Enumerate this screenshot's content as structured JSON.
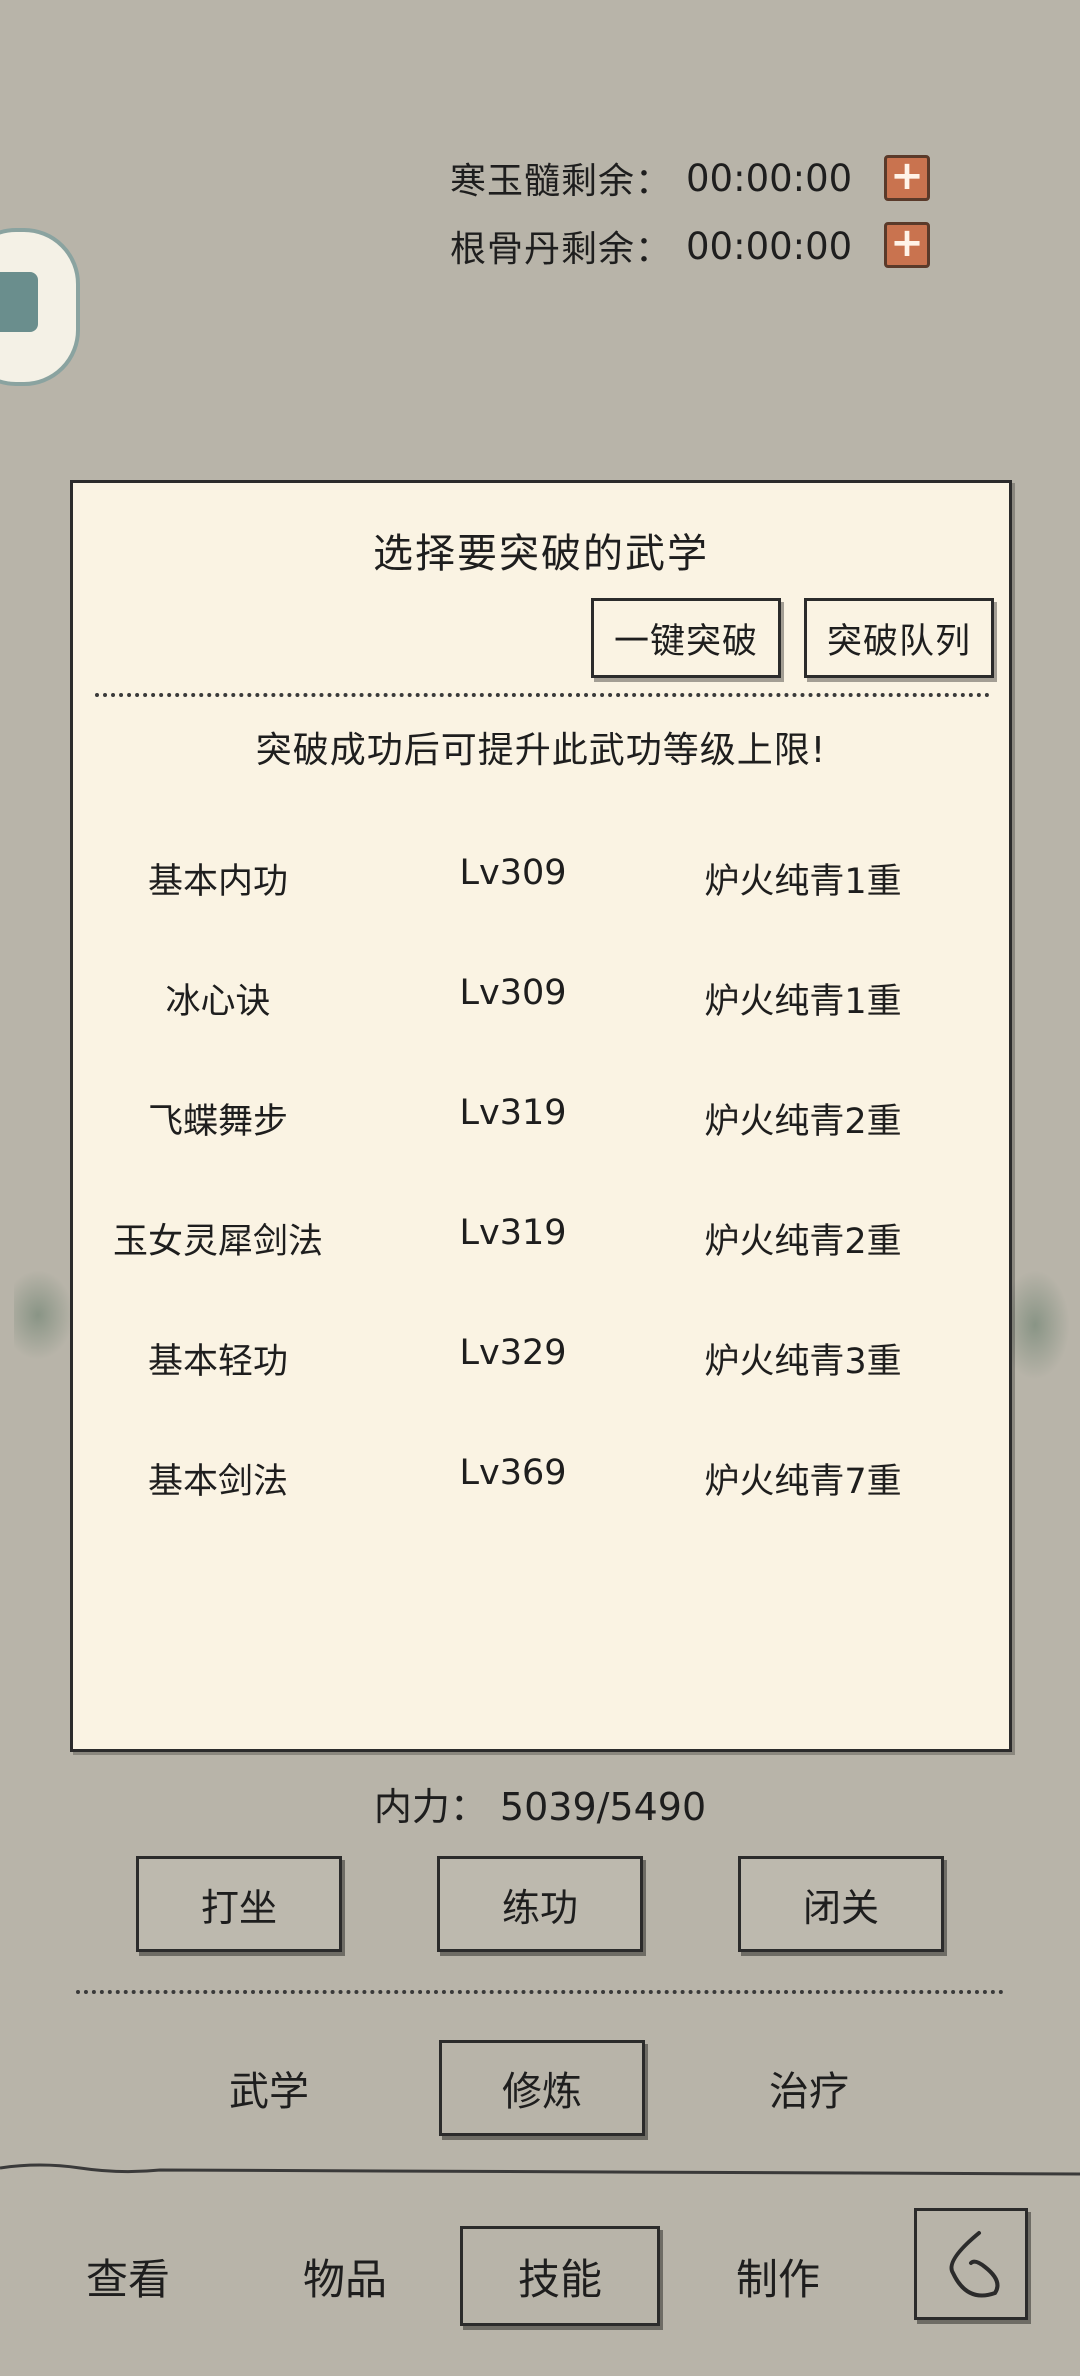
{
  "timers": [
    {
      "label": "寒玉髓剩余：",
      "value": "00:00:00",
      "action_icon": "plus-icon"
    },
    {
      "label": "根骨丹剩余：",
      "value": "00:00:00",
      "action_icon": "plus-icon"
    }
  ],
  "dialog": {
    "title": "选择要突破的武学",
    "one_click_label": "一键突破",
    "queue_label": "突破队列",
    "note": "突破成功后可提升此武功等级上限!",
    "skills": [
      {
        "name": "基本内功",
        "level": "Lv309",
        "requirement": "炉火纯青1重"
      },
      {
        "name": "冰心诀",
        "level": "Lv309",
        "requirement": "炉火纯青1重"
      },
      {
        "name": "飞蝶舞步",
        "level": "Lv319",
        "requirement": "炉火纯青2重"
      },
      {
        "name": "玉女灵犀剑法",
        "level": "Lv319",
        "requirement": "炉火纯青2重"
      },
      {
        "name": "基本轻功",
        "level": "Lv329",
        "requirement": "炉火纯青3重"
      },
      {
        "name": "基本剑法",
        "level": "Lv369",
        "requirement": "炉火纯青7重"
      }
    ]
  },
  "neili": "内力：  5039/5490",
  "actions": {
    "meditate": "打坐",
    "practice": "练功",
    "seclusion": "闭关"
  },
  "subtabs": {
    "martial": "武学",
    "cultivate": "修炼",
    "heal": "治疗"
  },
  "nav": {
    "view": "查看",
    "items": "物品",
    "skills": "技能",
    "craft": "制作"
  },
  "colors": {
    "background": "#b8b4a9",
    "dialog_bg": "#faf3e3",
    "plus_button": "#c9734f"
  }
}
